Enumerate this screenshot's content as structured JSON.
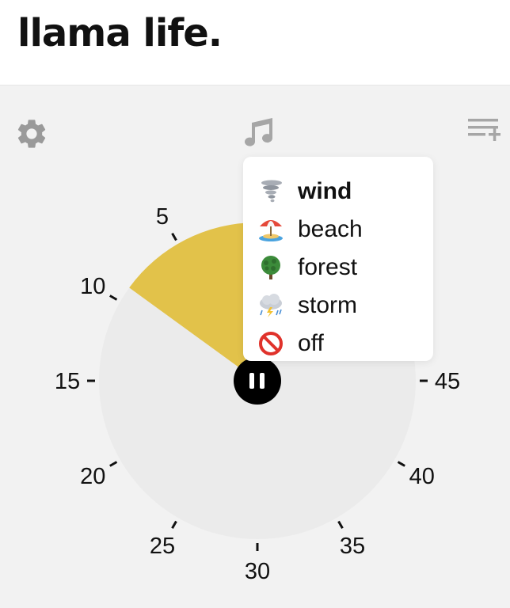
{
  "header": {
    "logo": "llama life."
  },
  "toolbar": {
    "settings_icon": "gear-icon",
    "music_icon": "music-note-icon",
    "queue_icon": "add-to-list-icon"
  },
  "timer": {
    "state": "running",
    "elapsed_minutes": 9,
    "total_minutes": 60,
    "progress_color": "#e2c24a",
    "face_color": "#ebebeb",
    "control_icon": "pause-icon"
  },
  "dial_labels": [
    "5",
    "10",
    "15",
    "20",
    "25",
    "30",
    "35",
    "40",
    "45"
  ],
  "sound_menu": {
    "selected": "wind",
    "items": [
      {
        "label": "wind",
        "icon": "tornado-icon"
      },
      {
        "label": "beach",
        "icon": "beach-umbrella-icon"
      },
      {
        "label": "forest",
        "icon": "tree-icon"
      },
      {
        "label": "storm",
        "icon": "storm-cloud-icon"
      },
      {
        "label": "off",
        "icon": "prohibited-icon"
      }
    ]
  }
}
